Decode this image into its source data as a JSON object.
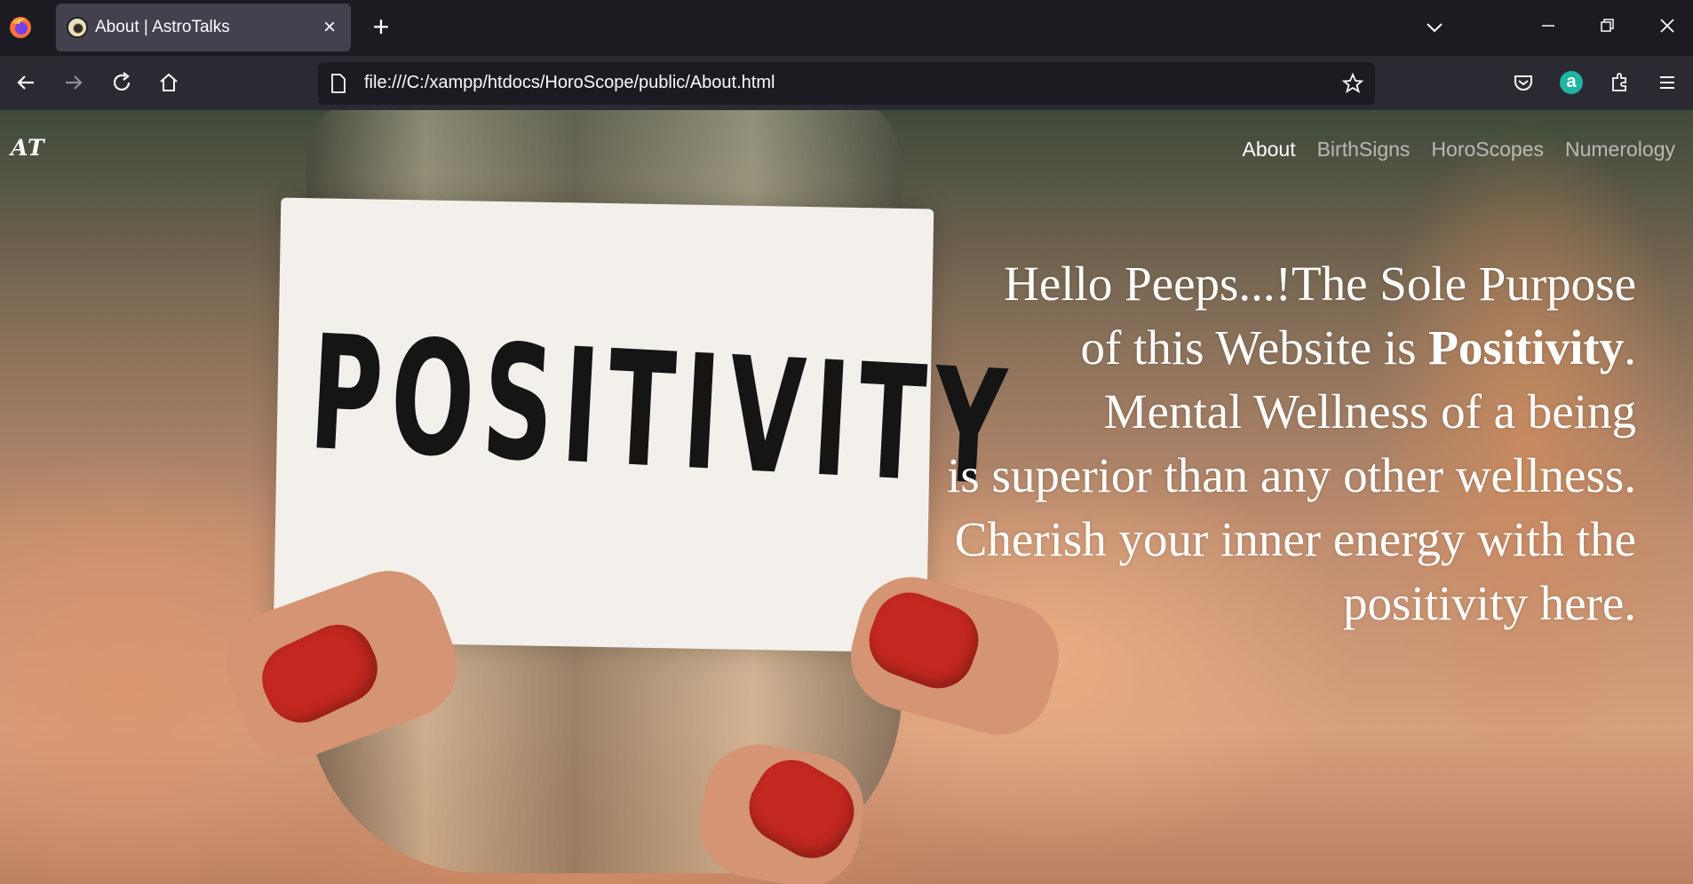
{
  "browser": {
    "tab_title": "About | AstroTalks",
    "url": "file:///C:/xampp/htdocs/HoroScope/public/About.html"
  },
  "site": {
    "brand": "AT",
    "nav": [
      "About",
      "BirthSigns",
      "HoroScopes",
      "Numerology"
    ],
    "active_nav": "About"
  },
  "hero": {
    "line1": "Hello Peeps...!The Sole Purpose",
    "line2_pre": "of this Website is ",
    "line2_bold": "Positivity",
    "line2_post": ".",
    "line3": "Mental Wellness of a being",
    "line4": "is superior than any other wellness.",
    "line5": "Cherish your inner energy with the",
    "line6": "positivity here."
  },
  "image": {
    "label_text": "POSITIVITY"
  },
  "colors": {
    "chrome_dark": "#1c1b22",
    "toolbar": "#2b2a33",
    "tab_active": "#42414d",
    "nail_red": "#c2281f",
    "extension_teal": "#1fb5a1"
  }
}
